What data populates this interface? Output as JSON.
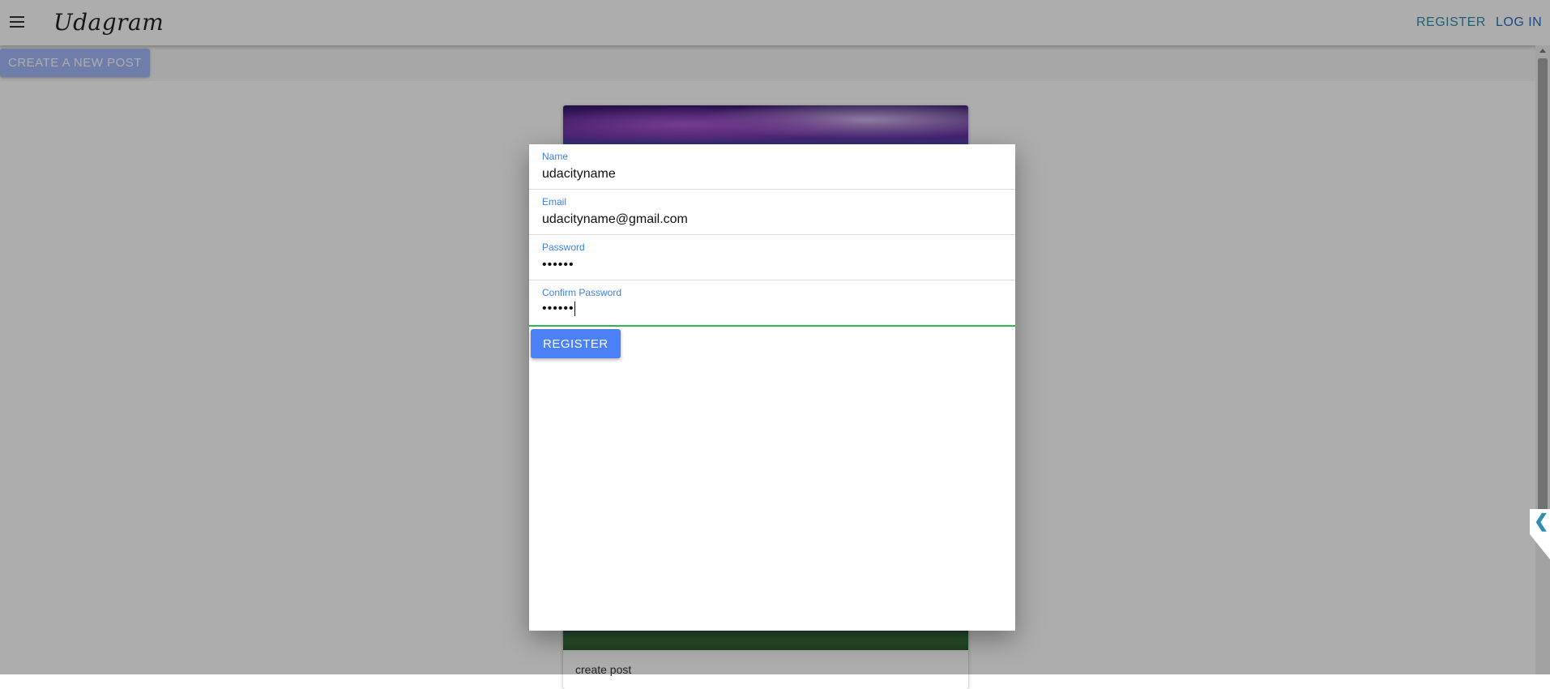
{
  "toolbar": {
    "brand": "Udagram",
    "register_label": "REGISTER",
    "login_label": "LOG IN"
  },
  "subbar": {
    "create_post_label": "CREATE A NEW POST"
  },
  "feed": {
    "post_caption": "create post"
  },
  "modal": {
    "name": {
      "label": "Name",
      "value": "udacityname"
    },
    "email": {
      "label": "Email",
      "value": "udacityname@gmail.com"
    },
    "password": {
      "label": "Password",
      "value": "••••••"
    },
    "confirm_password": {
      "label": "Confirm Password",
      "value": "••••••"
    },
    "register_label": "REGISTER"
  },
  "side_tab": {
    "icon": "chevron-left-icon",
    "glyph": "❮"
  },
  "colors": {
    "accent": "#4c80f7",
    "label_blue": "#3f7ee8",
    "valid_green": "#2db94d",
    "link_teal": "#2f8fae"
  }
}
